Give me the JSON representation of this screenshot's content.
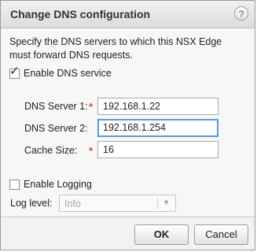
{
  "dialog": {
    "title": "Change DNS configuration",
    "help_label": "?",
    "description": "Specify the DNS servers to which this NSX Edge must forward DNS requests.",
    "enable_dns": {
      "label": "Enable DNS service",
      "checked": true,
      "mark": "✓"
    },
    "fields": {
      "dns1": {
        "label": "DNS Server 1:",
        "required_mark": "*",
        "value": "192.168.1.22"
      },
      "dns2": {
        "label": "DNS Server 2:",
        "value": "192.168.1.254"
      },
      "cache": {
        "label": "Cache Size:",
        "required_mark": "*",
        "value": "16"
      }
    },
    "enable_logging": {
      "label": "Enable Logging",
      "checked": false
    },
    "log_level": {
      "label": "Log level:",
      "value": "Info",
      "chevron": "▼"
    },
    "buttons": {
      "ok": "OK",
      "cancel": "Cancel"
    }
  }
}
